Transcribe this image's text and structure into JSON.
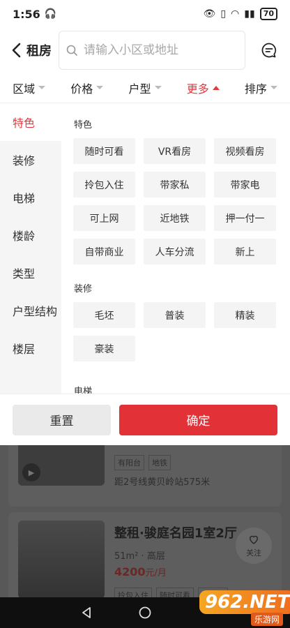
{
  "status": {
    "time": "1:56",
    "battery": "70"
  },
  "header": {
    "title": "租房",
    "search_placeholder": "请输入小区或地址"
  },
  "filters": [
    {
      "label": "区域",
      "active": false
    },
    {
      "label": "价格",
      "active": false
    },
    {
      "label": "户型",
      "active": false
    },
    {
      "label": "更多",
      "active": true
    },
    {
      "label": "排序",
      "active": false
    }
  ],
  "categories": [
    "特色",
    "装修",
    "电梯",
    "楼龄",
    "类型",
    "户型结构",
    "楼层"
  ],
  "sections": {
    "feature": {
      "title": "特色",
      "options": [
        "随时可看",
        "VR看房",
        "视频看房",
        "拎包入住",
        "带家私",
        "带家电",
        "可上网",
        "近地铁",
        "押一付一",
        "自带商业",
        "人车分流",
        "新上"
      ]
    },
    "decor": {
      "title": "装修",
      "options": [
        "毛坯",
        "普装",
        "精装",
        "豪装"
      ]
    },
    "elevator": {
      "title": "电梯"
    }
  },
  "actions": {
    "reset": "重置",
    "confirm": "确定"
  },
  "listing1": {
    "tags": [
      "有阳台",
      "地铁"
    ],
    "distance": "距2号线黄贝岭站575米"
  },
  "listing2": {
    "title": "整租·骏庭名园1室2厅",
    "area": "51m²",
    "floor": "高层",
    "price": "4200",
    "price_unit": "元/月",
    "tags": [
      "拎包入住",
      "随时可看",
      "带家私"
    ],
    "follow": "关注"
  },
  "watermark": {
    "logo": "962.NET",
    "sub": "乐游网"
  },
  "colors": {
    "accent": "#e03a3e",
    "confirm": "#e33237"
  }
}
